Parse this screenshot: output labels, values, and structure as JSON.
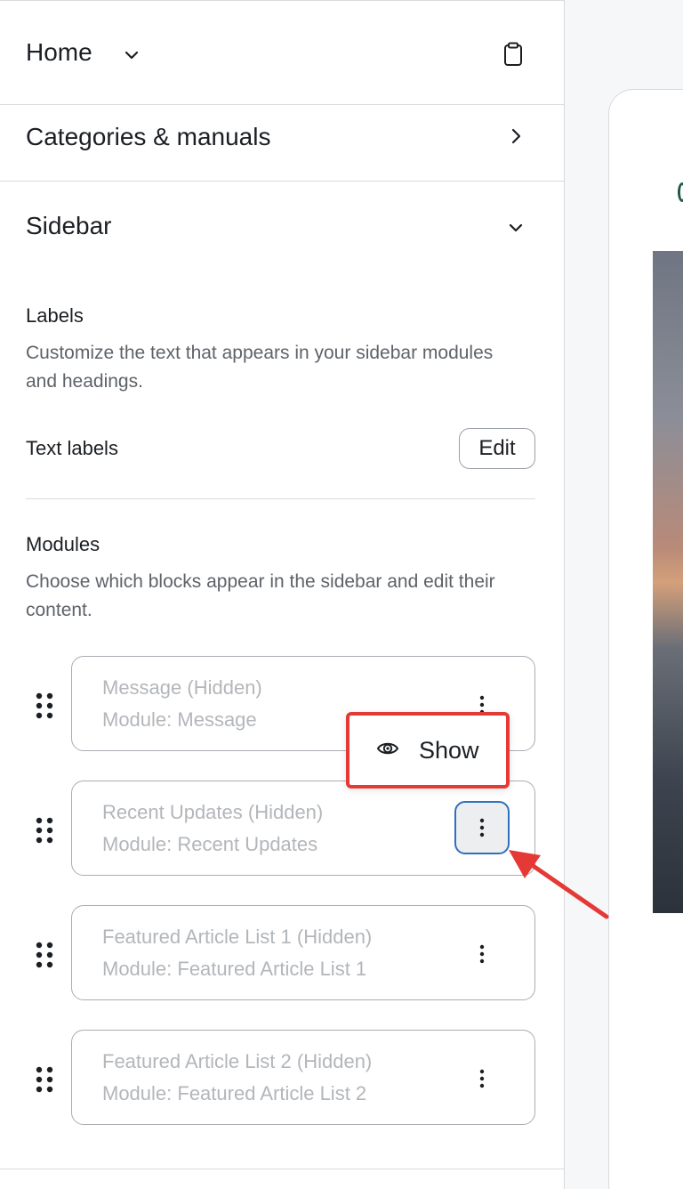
{
  "header": {
    "title": "Home"
  },
  "categories": {
    "label": "Categories & manuals"
  },
  "sidebar": {
    "title": "Sidebar",
    "labels": {
      "heading": "Labels",
      "description": "Customize the text that appears in your sidebar modules and headings.",
      "text_labels": "Text labels",
      "edit_label": "Edit"
    },
    "modules": {
      "heading": "Modules",
      "description": "Choose which blocks appear in the sidebar and edit their content.",
      "items": [
        {
          "title": "Message (Hidden)",
          "subtitle": "Module: Message"
        },
        {
          "title": "Recent Updates (Hidden)",
          "subtitle": "Module: Recent Updates"
        },
        {
          "title": "Featured Article List 1 (Hidden)",
          "subtitle": "Module: Featured Article List 1"
        },
        {
          "title": "Featured Article List 2 (Hidden)",
          "subtitle": "Module: Featured Article List 2"
        }
      ]
    }
  },
  "popover": {
    "show_label": "Show"
  },
  "colors": {
    "highlight": "#e53935",
    "focus": "#2f6fc0",
    "hidden_text": "#b3b6ba"
  }
}
